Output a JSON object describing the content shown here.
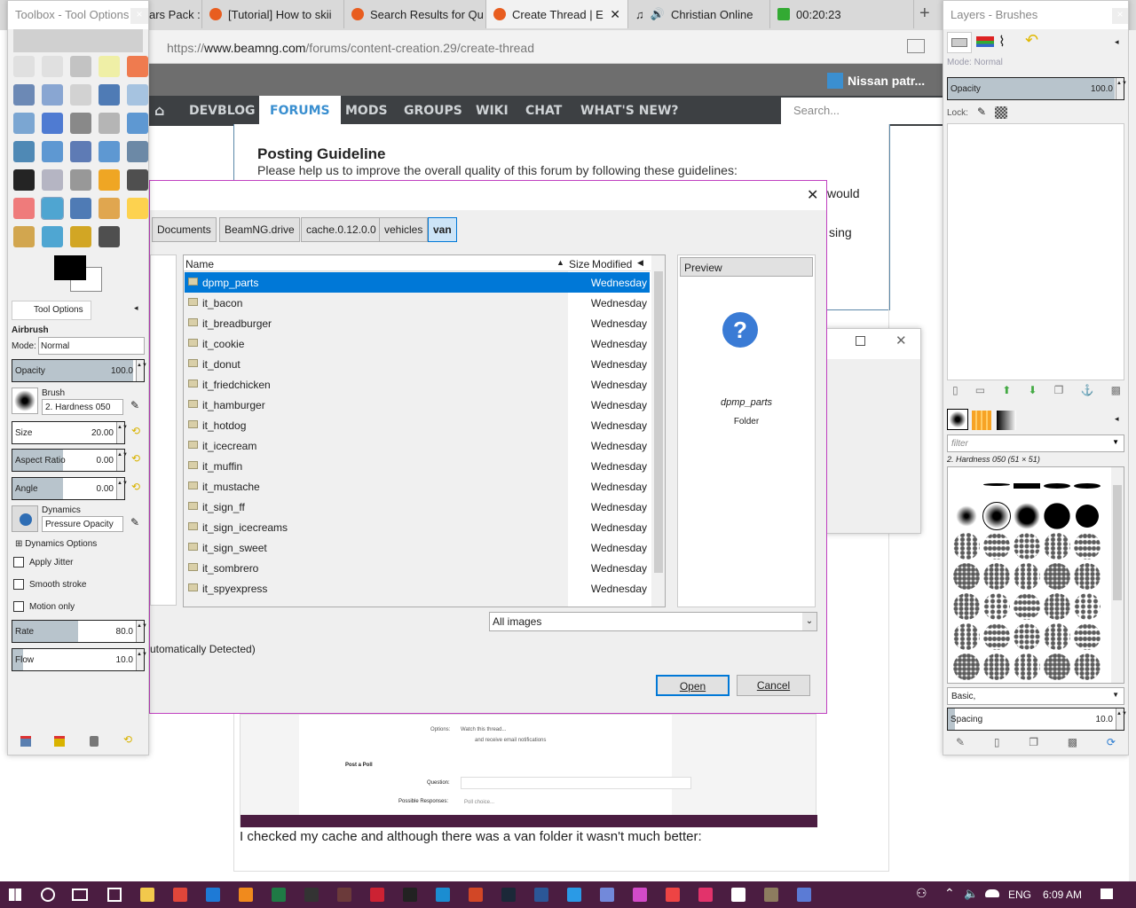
{
  "browser": {
    "tabs": [
      {
        "label": "ars Pack :"
      },
      {
        "label": "[Tutorial] How to skii"
      },
      {
        "label": "Search Results for Qu"
      },
      {
        "label": "Create Thread | E",
        "active": true
      },
      {
        "label": "Christian Online"
      },
      {
        "label": "00:20:23"
      }
    ],
    "new_tab": "+",
    "url_prefix": "https://",
    "url_domain": "www.beamng.com",
    "url_path": "/forums/content-creation.29/create-thread"
  },
  "forum": {
    "user": "Nissan patr...",
    "nav": [
      "DEVBLOG",
      "FORUMS",
      "MODS",
      "GROUPS",
      "WIKI",
      "CHAT",
      "WHAT'S NEW?"
    ],
    "search_placeholder": "Search...",
    "guide_title": "Posting Guideline",
    "guide_text": "Please help us to improve the overall quality of this forum by following these guidelines:",
    "guide_frag1": "would",
    "guide_frag2": "sing",
    "embedded": {
      "options": "Options:",
      "watch": "Watch this thread...",
      "email": "and receive email notifications",
      "poll": "Post a Poll",
      "question": "Question:",
      "responses": "Possible Responses:",
      "poll_choice": "Poll choice..."
    },
    "post_text": "I checked my cache and although there was a van folder it wasn't much better:"
  },
  "toolbox": {
    "title": "Toolbox - Tool Options",
    "tab": "Tool Options",
    "tool_name": "Airbrush",
    "mode_label": "Mode:",
    "mode": "Normal",
    "opacity_label": "Opacity",
    "opacity": "100.0",
    "brush_label": "Brush",
    "brush": "2. Hardness 050",
    "size_label": "Size",
    "size": "20.00",
    "aspect_label": "Aspect Ratio",
    "aspect": "0.00",
    "angle_label": "Angle",
    "angle": "0.00",
    "dynamics_label": "Dynamics",
    "dynamics": "Pressure Opacity",
    "dynamics_options": "Dynamics Options",
    "apply_jitter": "Apply Jitter",
    "smooth_stroke": "Smooth stroke",
    "motion_only": "Motion only",
    "rate_label": "Rate",
    "rate": "80.0",
    "rate_fraction": 0.6,
    "flow_label": "Flow",
    "flow": "10.0",
    "flow_fraction": 0.1,
    "fg_color": "#000000",
    "bg_color": "#ffffff"
  },
  "layers": {
    "title": "Layers - Brushes",
    "mode_label": "Mode:",
    "mode": "Normal",
    "opacity_label": "Opacity",
    "opacity": "100.0",
    "lock_label": "Lock:",
    "filter_placeholder": "filter",
    "brush_name": "2. Hardness 050 (51 × 51)",
    "brush_set": "Basic,",
    "spacing_label": "Spacing",
    "spacing": "10.0"
  },
  "dialog": {
    "path": [
      "Documents",
      "BeamNG.drive",
      "cache.0.12.0.0",
      "vehicles",
      "van"
    ],
    "col_name": "Name",
    "col_size": "Size",
    "col_modified": "Modified",
    "files": [
      {
        "name": "dpmp_parts",
        "modified": "Wednesday"
      },
      {
        "name": "it_bacon",
        "modified": "Wednesday"
      },
      {
        "name": "it_breadburger",
        "modified": "Wednesday"
      },
      {
        "name": "it_cookie",
        "modified": "Wednesday"
      },
      {
        "name": "it_donut",
        "modified": "Wednesday"
      },
      {
        "name": "it_friedchicken",
        "modified": "Wednesday"
      },
      {
        "name": "it_hamburger",
        "modified": "Wednesday"
      },
      {
        "name": "it_hotdog",
        "modified": "Wednesday"
      },
      {
        "name": "it_icecream",
        "modified": "Wednesday"
      },
      {
        "name": "it_muffin",
        "modified": "Wednesday"
      },
      {
        "name": "it_mustache",
        "modified": "Wednesday"
      },
      {
        "name": "it_sign_ff",
        "modified": "Wednesday"
      },
      {
        "name": "it_sign_icecreams",
        "modified": "Wednesday"
      },
      {
        "name": "it_sign_sweet",
        "modified": "Wednesday"
      },
      {
        "name": "it_sombrero",
        "modified": "Wednesday"
      },
      {
        "name": "it_spyexpress",
        "modified": "Wednesday"
      }
    ],
    "preview_label": "Preview",
    "preview_name": "dpmp_parts",
    "preview_type": "Folder",
    "filter": "All images",
    "file_type": "utomatically Detected)",
    "open": "Open",
    "cancel": "Cancel"
  },
  "taskbar": {
    "language": "ENG",
    "time": "6:09 AM",
    "apps": [
      {
        "name": "file-explorer",
        "color": "#f2c94c"
      },
      {
        "name": "chrome",
        "color": "#e0463a"
      },
      {
        "name": "edge",
        "color": "#1e7ad6"
      },
      {
        "name": "firefox",
        "color": "#f08a1d"
      },
      {
        "name": "excel",
        "color": "#1f7a45"
      },
      {
        "name": "game-1",
        "color": "#333"
      },
      {
        "name": "game-2",
        "color": "#6b3a3a"
      },
      {
        "name": "game-3",
        "color": "#c23"
      },
      {
        "name": "game-4",
        "color": "#222"
      },
      {
        "name": "3d-app",
        "color": "#1b8dd1"
      },
      {
        "name": "powerpoint",
        "color": "#d24726"
      },
      {
        "name": "steam",
        "color": "#1b2838"
      },
      {
        "name": "word",
        "color": "#2b5797"
      },
      {
        "name": "internet-explorer",
        "color": "#2a9ae6"
      },
      {
        "name": "discord",
        "color": "#7289da"
      },
      {
        "name": "app-pink",
        "color": "#d24bc8"
      },
      {
        "name": "paint",
        "color": "#e44"
      },
      {
        "name": "app-red",
        "color": "#e2336b"
      },
      {
        "name": "notes",
        "color": "#fff"
      },
      {
        "name": "gimp",
        "color": "#8d7c5f"
      },
      {
        "name": "paint-app",
        "color": "#5b7bd5"
      }
    ]
  }
}
